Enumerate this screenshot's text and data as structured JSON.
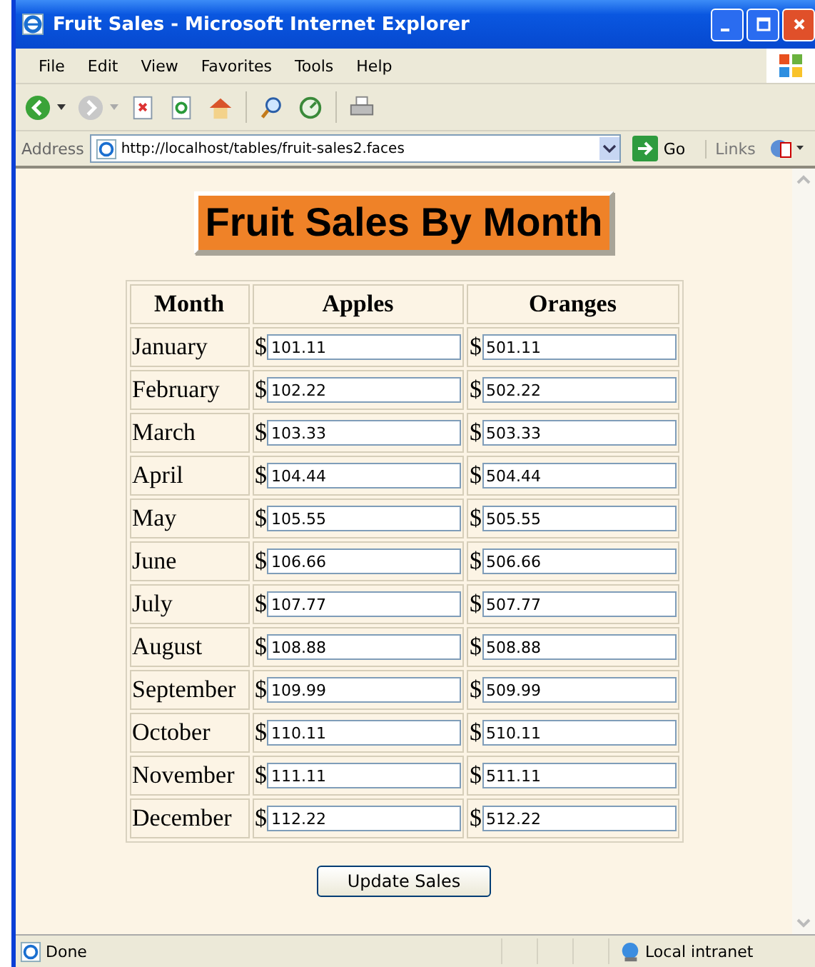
{
  "window": {
    "title": "Fruit Sales - Microsoft Internet Explorer"
  },
  "menu": [
    "File",
    "Edit",
    "View",
    "Favorites",
    "Tools",
    "Help"
  ],
  "address_bar": {
    "label": "Address",
    "url": "http://localhost/tables/fruit-sales2.faces",
    "go": "Go",
    "links": "Links"
  },
  "page": {
    "heading": "Fruit Sales By Month",
    "table": {
      "columns": [
        "Month",
        "Apples",
        "Oranges"
      ],
      "rows": [
        {
          "month": "January",
          "apples": "101.11",
          "oranges": "501.11"
        },
        {
          "month": "February",
          "apples": "102.22",
          "oranges": "502.22"
        },
        {
          "month": "March",
          "apples": "103.33",
          "oranges": "503.33"
        },
        {
          "month": "April",
          "apples": "104.44",
          "oranges": "504.44"
        },
        {
          "month": "May",
          "apples": "105.55",
          "oranges": "505.55"
        },
        {
          "month": "June",
          "apples": "106.66",
          "oranges": "506.66"
        },
        {
          "month": "July",
          "apples": "107.77",
          "oranges": "507.77"
        },
        {
          "month": "August",
          "apples": "108.88",
          "oranges": "508.88"
        },
        {
          "month": "September",
          "apples": "109.99",
          "oranges": "509.99"
        },
        {
          "month": "October",
          "apples": "110.11",
          "oranges": "510.11"
        },
        {
          "month": "November",
          "apples": "111.11",
          "oranges": "511.11"
        },
        {
          "month": "December",
          "apples": "112.22",
          "oranges": "512.22"
        }
      ],
      "currency": "$"
    },
    "button": "Update Sales"
  },
  "status_bar": {
    "text": "Done",
    "zone": "Local intranet"
  }
}
